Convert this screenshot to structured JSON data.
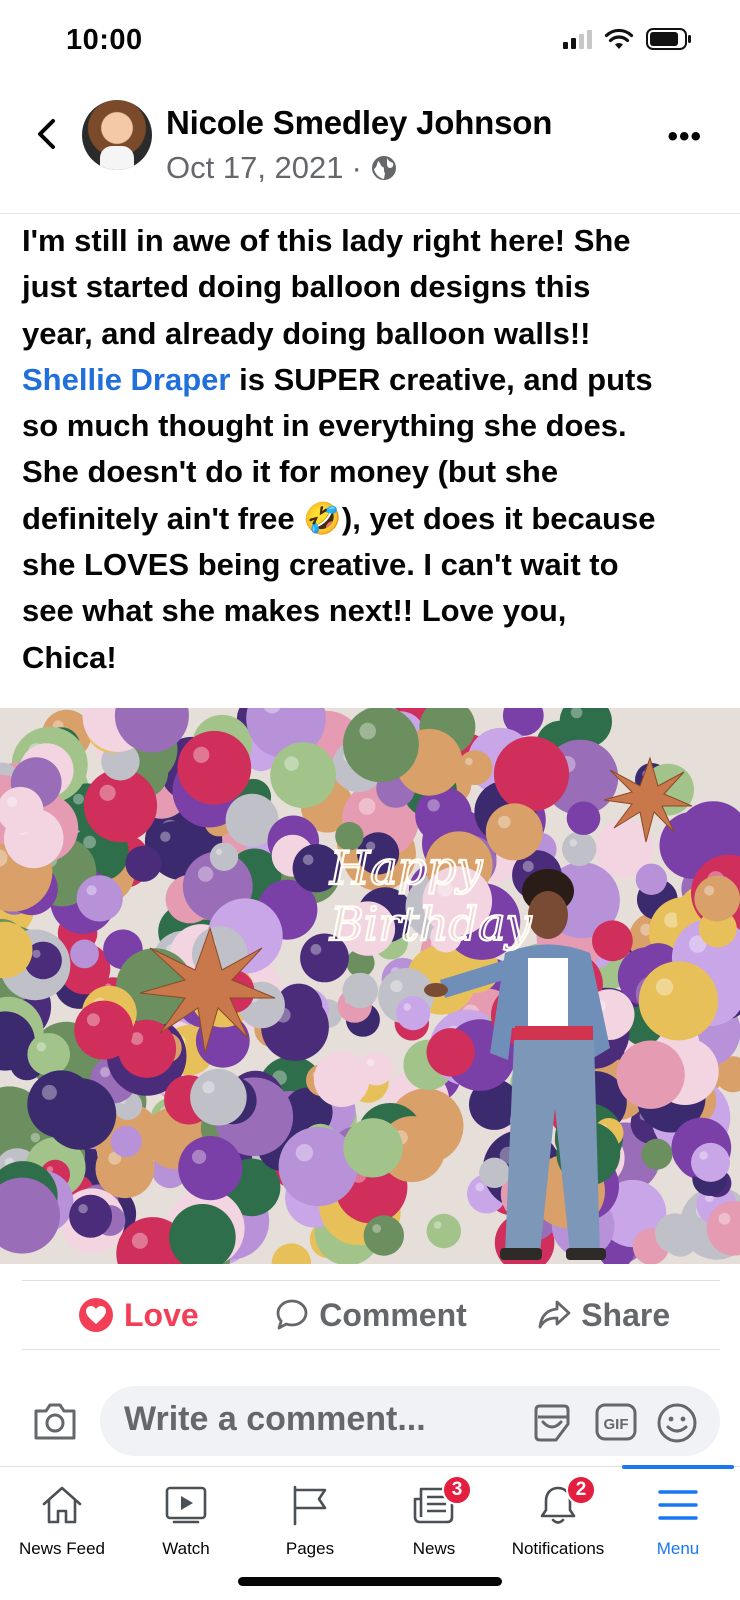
{
  "status_bar": {
    "time": "10:00"
  },
  "post": {
    "author": "Nicole Smedley Johnson",
    "date": "Oct 17, 2021",
    "separator": "·",
    "text_lines": [
      "I'm still in awe of this lady right here!  She",
      "just started doing balloon designs this",
      "year, and already doing balloon walls!!"
    ],
    "mention": "Shellie Draper",
    "mention_rest": " is SUPER creative, and puts",
    "text_lines_2": [
      "so much thought in everything she does.",
      "She doesn't do it for money (but she"
    ],
    "line_emoji_before": "definitely ain't free ",
    "emoji": "🤣",
    "line_emoji_after": "), yet does it because",
    "text_lines_3": [
      "she LOVES being creative.   I can't wait to",
      "see what she makes next!! Love you,",
      "Chica!"
    ],
    "photo_sign": {
      "line1": "Happy",
      "line2": "Birthday"
    }
  },
  "actions": {
    "love": "Love",
    "comment": "Comment",
    "share": "Share"
  },
  "comment": {
    "placeholder": "Write a comment..."
  },
  "tabs": [
    {
      "label": "News Feed",
      "icon": "home-icon"
    },
    {
      "label": "Watch",
      "icon": "watch-icon"
    },
    {
      "label": "Pages",
      "icon": "flag-icon"
    },
    {
      "label": "News",
      "icon": "newspaper-icon",
      "badge": "3"
    },
    {
      "label": "Notifications",
      "icon": "bell-icon",
      "badge": "2"
    },
    {
      "label": "Menu",
      "icon": "menu-icon",
      "active": true
    }
  ],
  "colors": {
    "accent": "#1877f2",
    "love": "#f33e58",
    "link": "#216fdb",
    "badge": "#e41e3f"
  }
}
